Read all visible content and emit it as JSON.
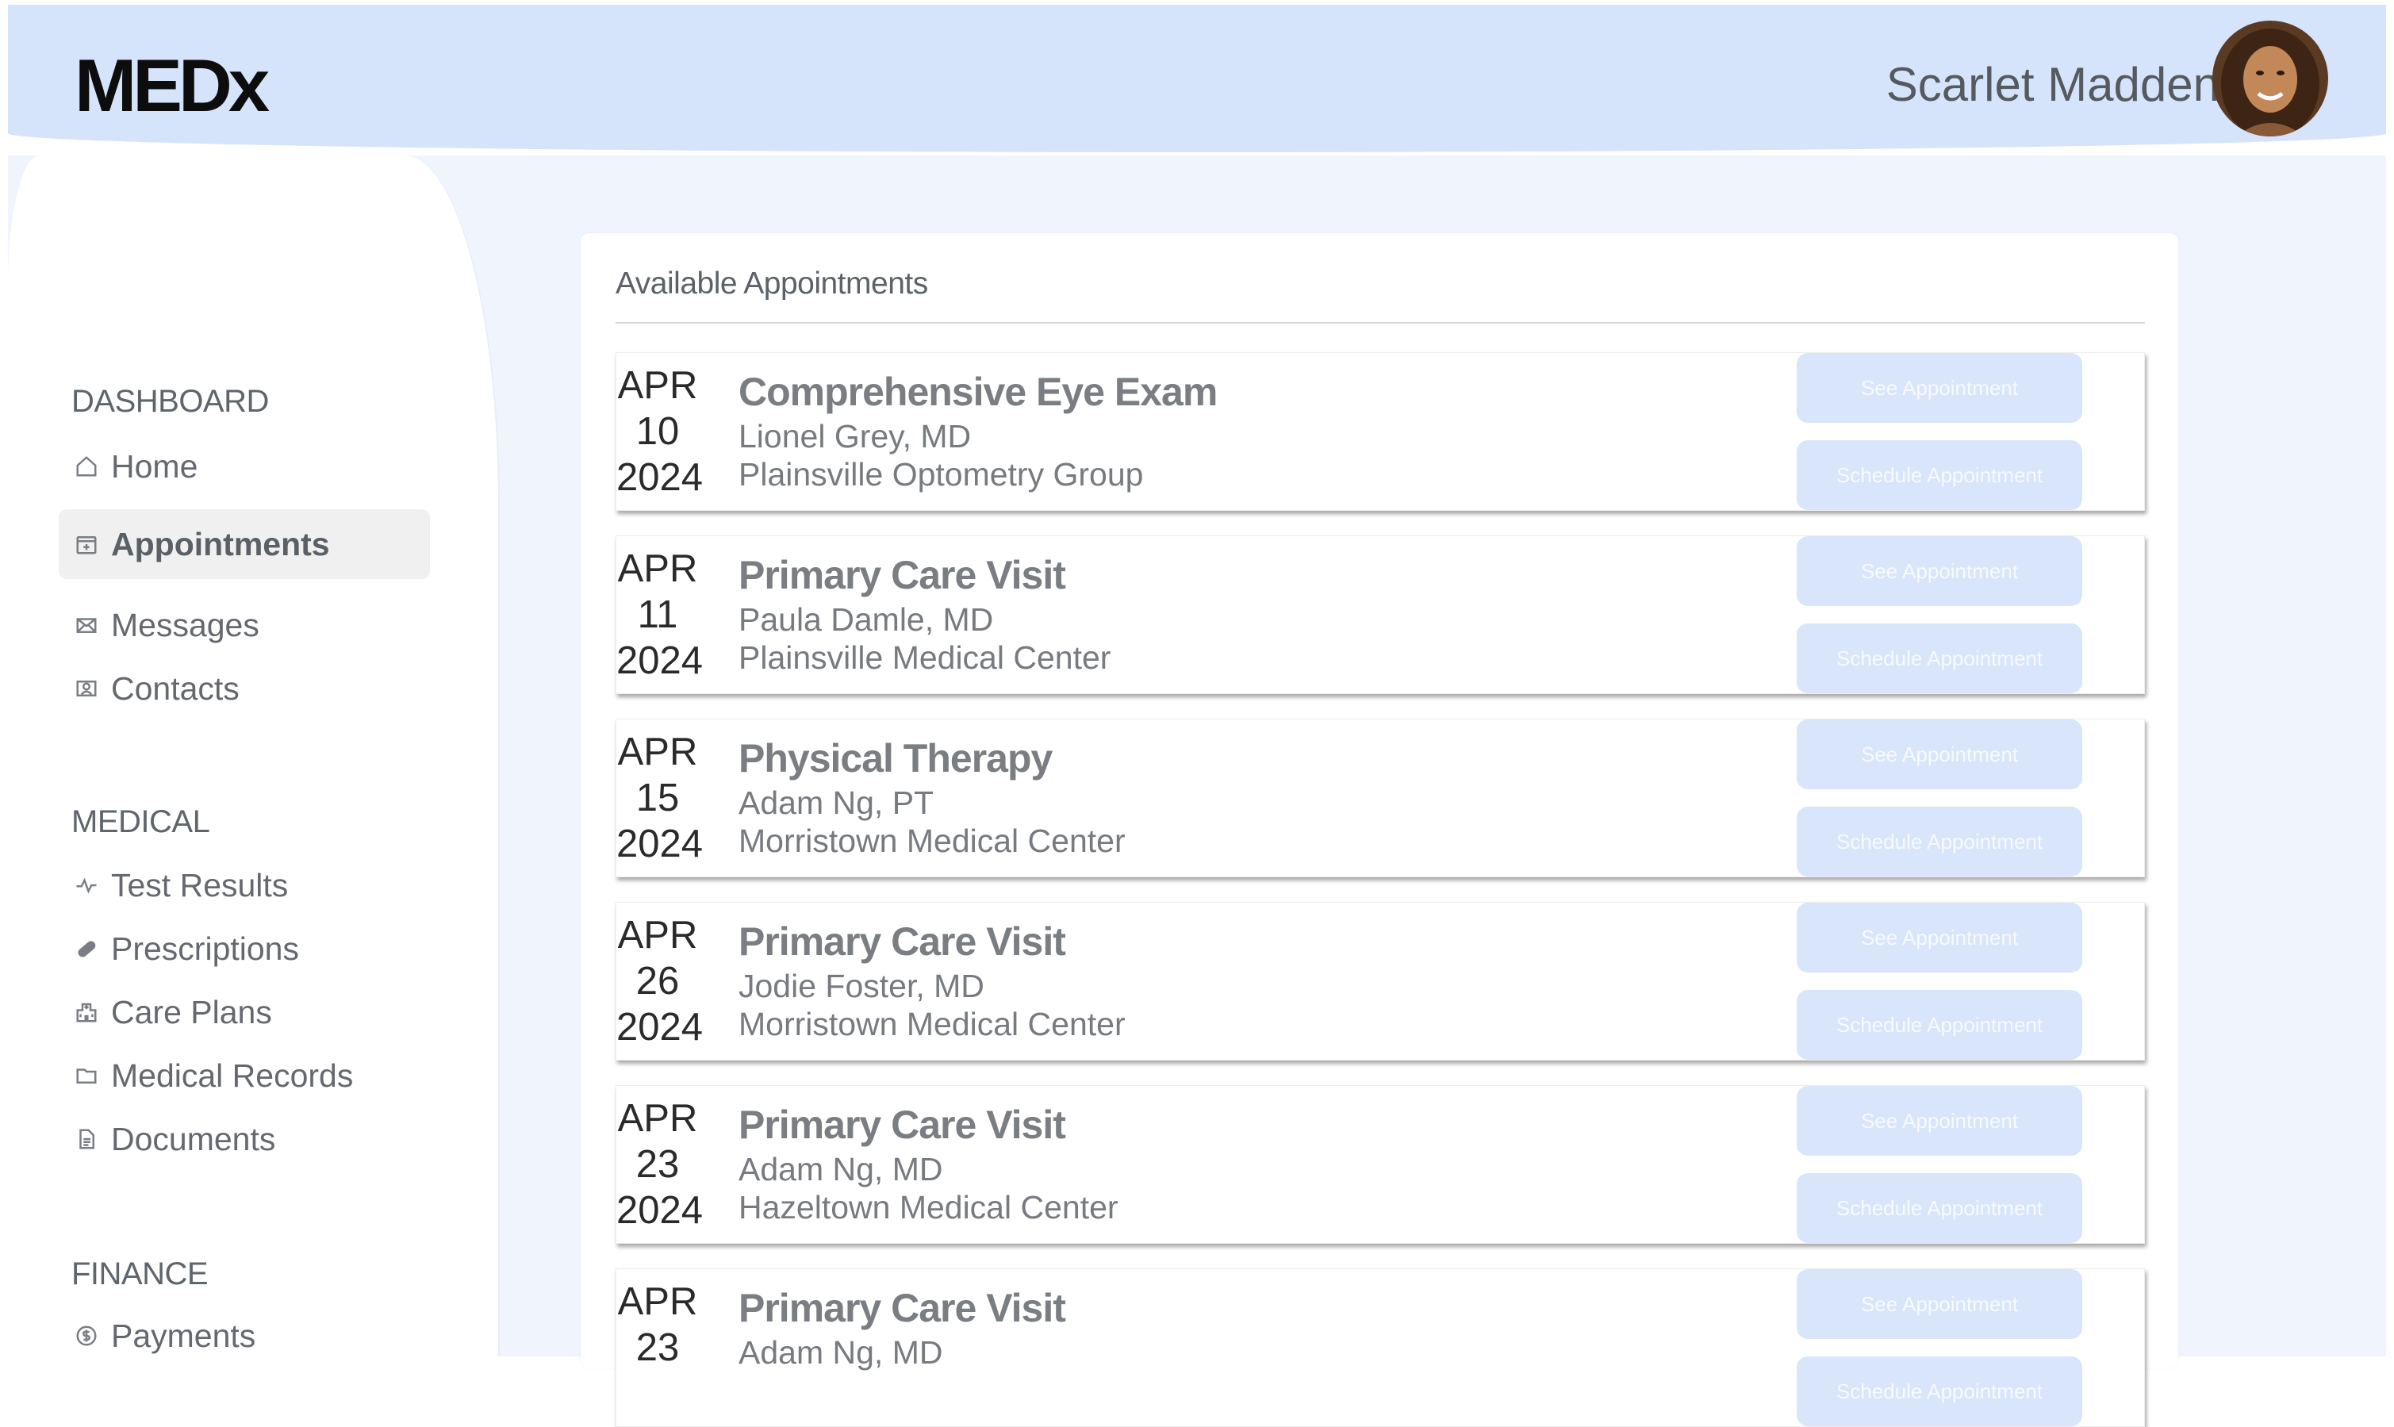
{
  "header": {
    "logo": "MEDx",
    "user_name": "Scarlet Madden"
  },
  "sidebar": {
    "sections": [
      {
        "title": "DASHBOARD",
        "items": [
          {
            "label": "Home",
            "icon": "home-icon"
          },
          {
            "label": "Appointments",
            "icon": "calendar-plus-icon",
            "active": true
          },
          {
            "label": "Messages",
            "icon": "envelope-icon"
          },
          {
            "label": "Contacts",
            "icon": "contact-card-icon"
          }
        ]
      },
      {
        "title": "MEDICAL",
        "items": [
          {
            "label": "Test Results",
            "icon": "pulse-icon"
          },
          {
            "label": "Prescriptions",
            "icon": "pill-icon"
          },
          {
            "label": "Care Plans",
            "icon": "hospital-icon"
          },
          {
            "label": "Medical Records",
            "icon": "folder-icon"
          },
          {
            "label": "Documents",
            "icon": "document-icon"
          }
        ]
      },
      {
        "title": "FINANCE",
        "items": [
          {
            "label": "Payments",
            "icon": "dollar-circle-icon"
          }
        ]
      }
    ]
  },
  "main": {
    "panel_title": "Available Appointments",
    "see_label": "See Appointment",
    "schedule_label": "Schedule Appointment",
    "appointments": [
      {
        "month": "APR",
        "day": "10",
        "year": "2024",
        "title": "Comprehensive Eye Exam",
        "doctor": "Lionel Grey, MD",
        "location": "Plainsville Optometry Group"
      },
      {
        "month": "APR",
        "day": "11",
        "year": "2024",
        "title": "Primary Care Visit",
        "doctor": "Paula Damle, MD",
        "location": "Plainsville Medical Center"
      },
      {
        "month": "APR",
        "day": "15",
        "year": "2024",
        "title": "Physical Therapy",
        "doctor": "Adam Ng, PT",
        "location": "Morristown Medical Center"
      },
      {
        "month": "APR",
        "day": "26",
        "year": "2024",
        "title": "Primary Care Visit",
        "doctor": "Jodie Foster, MD",
        "location": "Morristown Medical Center"
      },
      {
        "month": "APR",
        "day": "23",
        "year": "2024",
        "title": "Primary Care Visit",
        "doctor": "Adam Ng, MD",
        "location": "Hazeltown Medical Center"
      },
      {
        "month": "APR",
        "day": "23",
        "year": "",
        "title": "Primary Care Visit",
        "doctor": "Adam Ng, MD",
        "location": ""
      }
    ]
  },
  "colors": {
    "header_bg": "#d6e4fb",
    "canvas_bg": "#eff4fd",
    "button_bg": "#d8e5fb",
    "active_nav_bg": "#f0f0f0"
  }
}
